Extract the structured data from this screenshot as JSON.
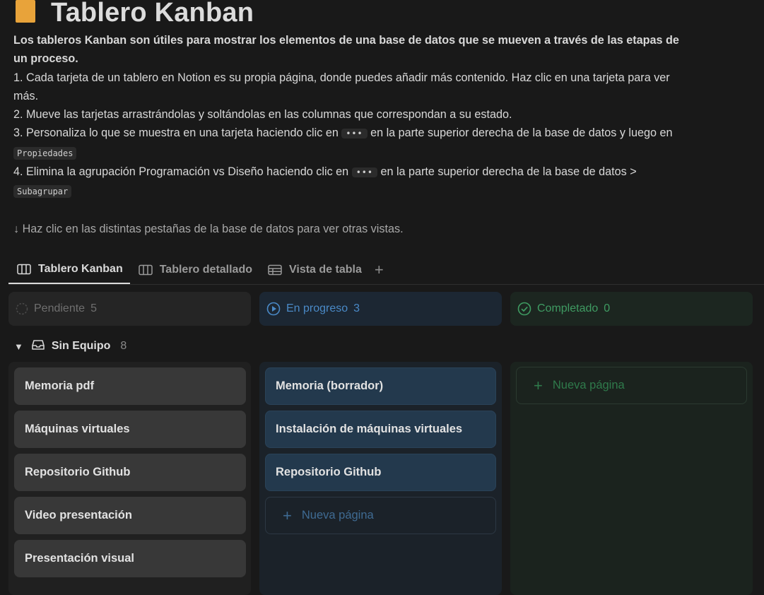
{
  "page": {
    "title": "Tablero Kanban",
    "icon": "page-icon"
  },
  "description": {
    "intro": "Los tableros Kanban son útiles para mostrar los elementos de una base de datos que se mueven a través de las etapas de un proceso.",
    "step1": "1. Cada tarjeta de un tablero en Notion es su propia página, donde puedes añadir más contenido. Haz clic en una tarjeta para ver más.",
    "step2": "2. Mueve las tarjetas arrastrándolas y soltándolas en las columnas que correspondan a su estado.",
    "step3_a": "3. Personaliza lo que se muestra en una tarjeta haciendo clic en",
    "step3_b": "en la parte superior derecha de la base de datos y luego en",
    "step3_code": "Propiedades",
    "step4_a": "4. Elimina la agrupación Programación vs Diseño haciendo clic en",
    "step4_b": "en la parte superior derecha de la base de datos >",
    "step4_code": "Subagrupar",
    "dots": "•••",
    "hint": "↓ Haz clic en las distintas pestañas de la base de datos para ver otras vistas."
  },
  "tabs": [
    {
      "label": "Tablero Kanban",
      "icon": "board-icon",
      "active": true
    },
    {
      "label": "Tablero detallado",
      "icon": "board-icon",
      "active": false
    },
    {
      "label": "Vista de tabla",
      "icon": "table-icon",
      "active": false
    }
  ],
  "tab_add": "+",
  "columns": [
    {
      "label": "Pendiente",
      "count": "5",
      "color": "#6f6f6f"
    },
    {
      "label": "En progreso",
      "count": "3",
      "color": "#4a8ac7"
    },
    {
      "label": "Completado",
      "count": "0",
      "color": "#3f9b62"
    }
  ],
  "group": {
    "label": "Sin Equipo",
    "count": "8",
    "toggle": "▼"
  },
  "cards_pendiente": [
    "Memoria pdf",
    "Máquinas virtuales",
    "Repositorio Github",
    "Video presentación",
    "Presentación visual"
  ],
  "cards_progreso": [
    "Memoria (borrador)",
    "Instalación de máquinas virtuales",
    "Repositorio Github"
  ],
  "new_page_label": "Nueva página",
  "new_page_plus": "+"
}
